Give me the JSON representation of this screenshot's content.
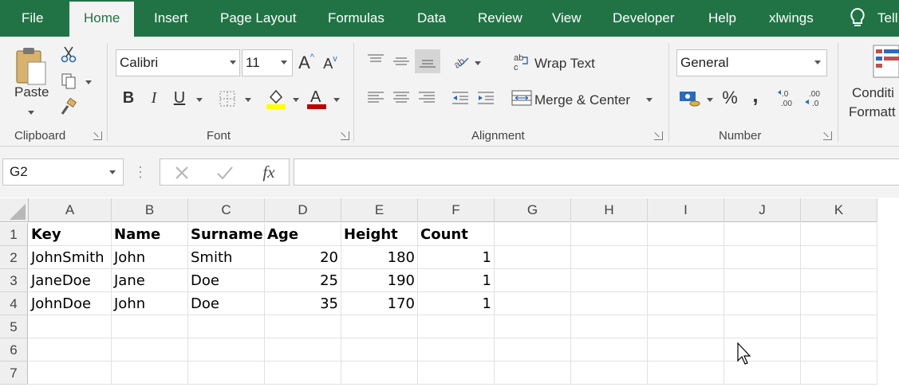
{
  "tabs": [
    {
      "label": "File"
    },
    {
      "label": "Home"
    },
    {
      "label": "Insert"
    },
    {
      "label": "Page Layout"
    },
    {
      "label": "Formulas"
    },
    {
      "label": "Data"
    },
    {
      "label": "Review"
    },
    {
      "label": "View"
    },
    {
      "label": "Developer"
    },
    {
      "label": "Help"
    },
    {
      "label": "xlwings"
    },
    {
      "label": "Tell"
    }
  ],
  "ribbon": {
    "clipboard": {
      "label": "Clipboard",
      "paste_label": "Paste"
    },
    "font": {
      "label": "Font",
      "font_name": "Calibri",
      "font_size": "11",
      "bold": "B",
      "italic": "I",
      "underline": "U"
    },
    "alignment": {
      "label": "Alignment",
      "wrap_text": "Wrap Text",
      "merge_center": "Merge & Center"
    },
    "number": {
      "label": "Number",
      "format": "General",
      "percent": "%",
      "comma": ","
    },
    "styles": {
      "conditional_line1": "Conditi",
      "conditional_line2": "Formatt"
    }
  },
  "formula_bar": {
    "name_box": "G2",
    "formula": "",
    "fx": "fx"
  },
  "grid": {
    "columns": [
      "A",
      "B",
      "C",
      "D",
      "E",
      "F",
      "G",
      "H",
      "I",
      "J",
      "K"
    ],
    "rows": [
      "1",
      "2",
      "3",
      "4",
      "5",
      "6",
      "7"
    ],
    "cells": [
      [
        "Key",
        "Name",
        "Surname",
        "Age",
        "Height",
        "Count"
      ],
      [
        "JohnSmith",
        "John",
        "Smith",
        "20",
        "180",
        "1"
      ],
      [
        "JaneDoe",
        "Jane",
        "Doe",
        "25",
        "190",
        "1"
      ],
      [
        "JohnDoe",
        "John",
        "Doe",
        "35",
        "170",
        "1"
      ]
    ]
  },
  "colors": {
    "accent": "#217346",
    "ribbon_bg": "#f3f3f3",
    "highlight_yellow": "#ffff00",
    "font_red": "#c00000"
  }
}
